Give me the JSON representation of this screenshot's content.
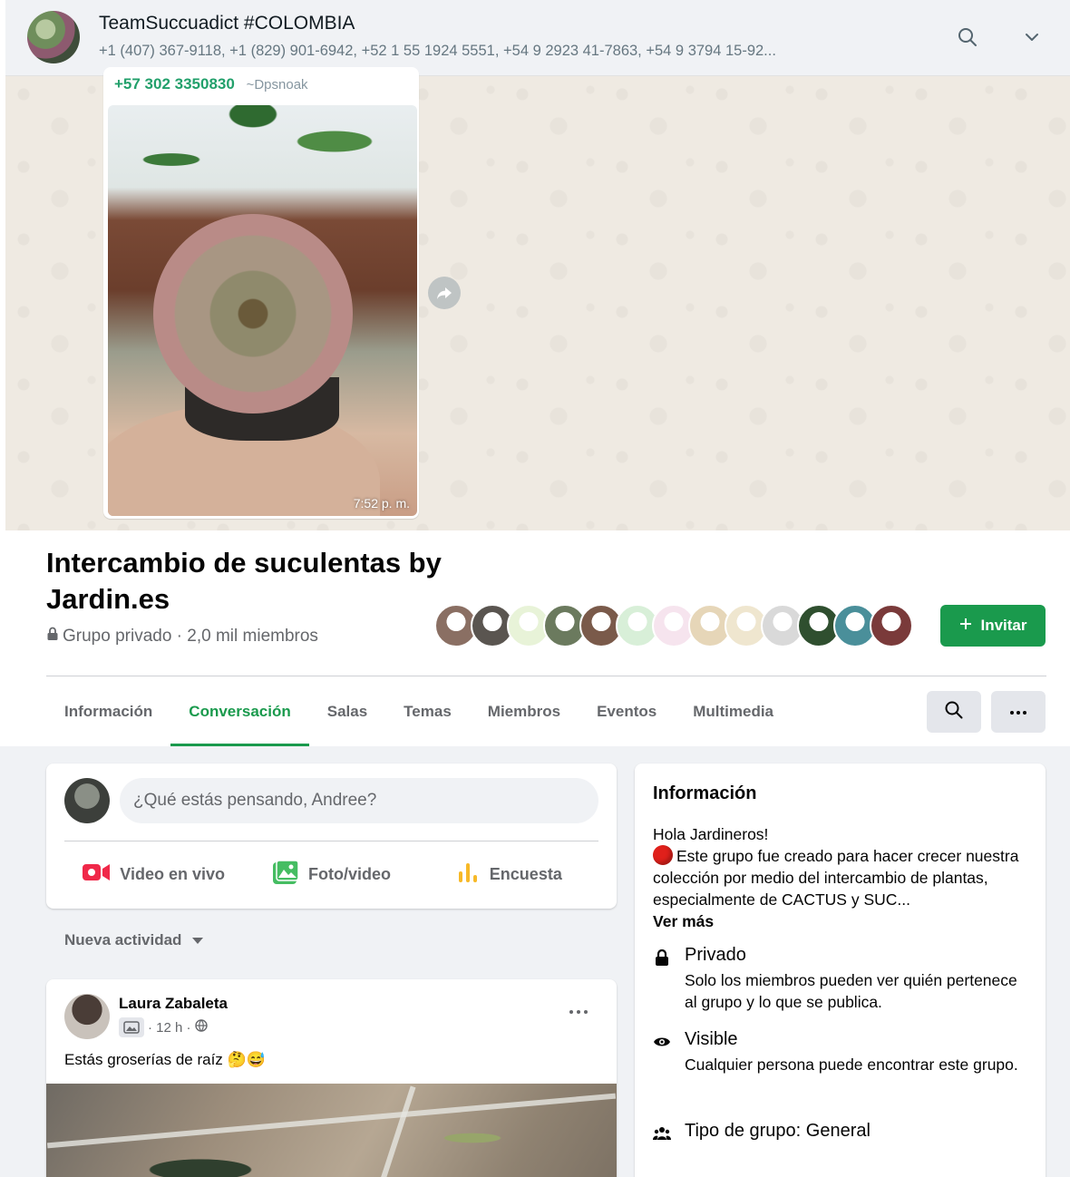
{
  "whatsapp": {
    "group_name": "TeamSuccuadict #COLOMBIA",
    "participants": "+1 (407) 367-9118, +1 (829) 901-6942, +52 1 55 1924 5551, +54 9 2923 41-7863, +54 9 3794 15-92...",
    "message": {
      "sender_number": "+57 302 3350830",
      "sender_alias": "~Dpsnoak",
      "time": "7:52 p. m."
    }
  },
  "group": {
    "title": "Intercambio de suculentas by Jardin.es",
    "privacy_meta": "Grupo privado · 2,0 mil miembros",
    "invite_label": "Invitar",
    "member_avatar_colors": [
      "#8a6f63",
      "#5a5550",
      "#e8f3d8",
      "#6b7a5e",
      "#7a5a4a",
      "#d8efd8",
      "#f6e4ee",
      "#e6d6b8",
      "#efe6cf",
      "#d9d9d9",
      "#2f4f2f",
      "#4a8f9a",
      "#7a3a3a"
    ],
    "tabs": [
      {
        "label": "Información",
        "active": false
      },
      {
        "label": "Conversación",
        "active": true
      },
      {
        "label": "Salas",
        "active": false
      },
      {
        "label": "Temas",
        "active": false
      },
      {
        "label": "Miembros",
        "active": false
      },
      {
        "label": "Eventos",
        "active": false
      },
      {
        "label": "Multimedia",
        "active": false
      }
    ]
  },
  "composer": {
    "placeholder": "¿Qué estás pensando, Andree?",
    "actions": {
      "live": "Video en vivo",
      "photo": "Foto/video",
      "poll": "Encuesta"
    }
  },
  "feed": {
    "sort_label": "Nueva actividad",
    "post": {
      "author": "Laura Zabaleta",
      "time": "· 12 h ·",
      "text": "Estás groserías de raíz 🤔😅"
    }
  },
  "about": {
    "heading": "Información",
    "greeting": "Hola Jardineros!",
    "description": "Este grupo fue creado para hacer crecer nuestra colección por medio del intercambio de plantas, especialmente de CACTUS y SUC...",
    "see_more": "Ver más",
    "private_title": "Privado",
    "private_desc": "Solo los miembros pueden ver quién pertenece al grupo y lo que se publica.",
    "visible_title": "Visible",
    "visible_desc": "Cualquier persona puede encontrar este grupo.",
    "type_label": "Tipo de grupo: General"
  },
  "colors": {
    "accent": "#1a9a4d",
    "wa_sender": "#22a06b",
    "live_icon": "#f02849",
    "photo_icon": "#45bd62",
    "poll_icon": "#f7b928"
  }
}
